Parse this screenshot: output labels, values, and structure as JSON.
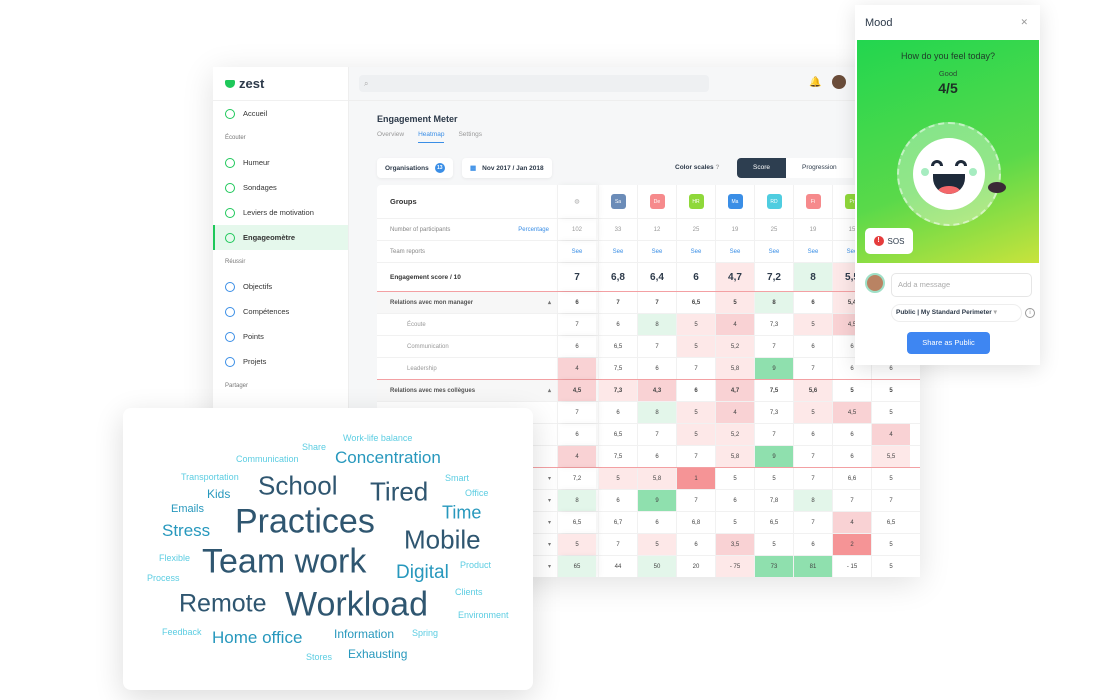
{
  "sidebar": {
    "logo": "zest",
    "items": [
      {
        "label": "Accueil"
      },
      {
        "section": "Écouter"
      },
      {
        "label": "Humeur"
      },
      {
        "label": "Sondages"
      },
      {
        "label": "Leviers de motivation"
      },
      {
        "label": "Engageomètre",
        "active": true
      },
      {
        "section": "Réussir"
      },
      {
        "label": "Objectifs"
      },
      {
        "label": "Compétences"
      },
      {
        "label": "Points"
      },
      {
        "label": "Projets"
      },
      {
        "section": "Partager"
      }
    ]
  },
  "page": {
    "title": "Engagement Meter",
    "tabs": [
      "Overview",
      "Heatmap",
      "Settings"
    ],
    "active_tab": "Heatmap",
    "organisations": "Organisations",
    "org_count": "13",
    "date_range": "Nov 2017 / Jan 2018",
    "color_scales": "Color scales",
    "scale_options": [
      "Score",
      "Progression"
    ],
    "scale_selected": "Score"
  },
  "heatmap": {
    "groups_label": "Groups",
    "columns": [
      {
        "tag": "Sa",
        "color": "#6b8cb8"
      },
      {
        "tag": "De",
        "color": "#f68a8c"
      },
      {
        "tag": "HR",
        "color": "#8fd83a"
      },
      {
        "tag": "Ma",
        "color": "#3a8ee6"
      },
      {
        "tag": "RD",
        "color": "#4fcde0"
      },
      {
        "tag": "Fi",
        "color": "#f68a8c"
      },
      {
        "tag": "Pr",
        "color": "#8fd83a"
      }
    ],
    "participants_label": "Number of participants",
    "percentage": "Percentage",
    "participants": [
      "102",
      "33",
      "12",
      "25",
      "19",
      "25",
      "19",
      "15"
    ],
    "team_reports_label": "Team reports",
    "see": "See",
    "rows": [
      {
        "label": "Engagement score / 10",
        "type": "big",
        "values": [
          "7",
          "6,8",
          "6,4",
          "6",
          "4,7",
          "7,2",
          "8",
          "5,5"
        ],
        "tones": [
          "",
          "",
          "",
          "",
          "r1",
          "",
          "g1",
          "r1"
        ]
      },
      {
        "label": "Relations avec mon manager",
        "type": "bold",
        "values": [
          "6",
          "7",
          "7",
          "6,5",
          "5",
          "8",
          "6",
          "5,4"
        ],
        "tones": [
          "",
          "",
          "",
          "",
          "r1",
          "g1",
          "",
          "r1"
        ]
      },
      {
        "label": "Écoute",
        "type": "sub",
        "values": [
          "7",
          "6",
          "8",
          "5",
          "4",
          "7,3",
          "5",
          "4,5"
        ],
        "tones": [
          "",
          "",
          "g1",
          "r1",
          "r2",
          "",
          "r1",
          "r2"
        ]
      },
      {
        "label": "Communication",
        "type": "sub",
        "values": [
          "6",
          "6,5",
          "7",
          "5",
          "5,2",
          "7",
          "6",
          "6"
        ],
        "tones": [
          "",
          "",
          "",
          "r1",
          "r1",
          "",
          "",
          ""
        ]
      },
      {
        "label": "Leadership",
        "type": "sub",
        "values": [
          "4",
          "7,5",
          "6",
          "7",
          "5,8",
          "9",
          "7",
          "6",
          "6"
        ],
        "tones": [
          "r2",
          "",
          "",
          "",
          "r1",
          "g2",
          "",
          "",
          ""
        ]
      },
      {
        "label": "Relations avec mes collègues",
        "type": "bold",
        "values": [
          "4,5",
          "7,3",
          "4,3",
          "6",
          "4,7",
          "7,5",
          "5,6",
          "5",
          "5"
        ],
        "tones": [
          "r2",
          "r1",
          "r2",
          "",
          "r2",
          "",
          "r1",
          "",
          ""
        ]
      },
      {
        "label": "",
        "type": "sub",
        "values": [
          "7",
          "6",
          "8",
          "5",
          "4",
          "7,3",
          "5",
          "4,5",
          "5"
        ],
        "tones": [
          "",
          "",
          "g1",
          "r1",
          "r2",
          "",
          "r1",
          "r2",
          ""
        ]
      },
      {
        "label": "",
        "type": "sub",
        "values": [
          "6",
          "6,5",
          "7",
          "5",
          "5,2",
          "7",
          "6",
          "6",
          "4"
        ],
        "tones": [
          "",
          "",
          "",
          "r1",
          "r1",
          "",
          "",
          "",
          "r2"
        ]
      },
      {
        "label": "",
        "type": "sub",
        "values": [
          "4",
          "7,5",
          "6",
          "7",
          "5,8",
          "9",
          "7",
          "6",
          "5,5"
        ],
        "tones": [
          "r2",
          "",
          "",
          "",
          "r1",
          "g2",
          "",
          "",
          "r1"
        ]
      },
      {
        "label": "",
        "type": "arrow",
        "values": [
          "7,2",
          "5",
          "5,8",
          "1",
          "5",
          "5",
          "7",
          "6,6",
          "5"
        ],
        "tones": [
          "",
          "r1",
          "r1",
          "r3",
          "",
          "",
          "",
          "",
          ""
        ]
      },
      {
        "label": "",
        "type": "arrow",
        "values": [
          "8",
          "6",
          "9",
          "7",
          "6",
          "7,8",
          "8",
          "7",
          "7"
        ],
        "tones": [
          "g1",
          "",
          "g2",
          "",
          "",
          "",
          "g1",
          "",
          ""
        ]
      },
      {
        "label": "",
        "type": "arrow",
        "values": [
          "6,5",
          "6,7",
          "6",
          "6,8",
          "5",
          "6,5",
          "7",
          "4",
          "6,5"
        ],
        "tones": [
          "",
          "",
          "",
          "",
          "",
          "",
          "",
          "r2",
          ""
        ]
      },
      {
        "label": "",
        "type": "arrow",
        "values": [
          "5",
          "7",
          "5",
          "6",
          "3,5",
          "5",
          "6",
          "2",
          "5"
        ],
        "tones": [
          "r1",
          "",
          "r1",
          "",
          "r2",
          "",
          "",
          "r3",
          ""
        ]
      },
      {
        "label": "",
        "type": "arrow",
        "values": [
          "65",
          "44",
          "50",
          "20",
          "- 75",
          "73",
          "81",
          "- 15",
          "5"
        ],
        "tones": [
          "g1",
          "",
          "g1",
          "",
          "r1",
          "g2",
          "g2",
          "",
          ""
        ]
      }
    ]
  },
  "wordcloud": [
    "Work-life balance",
    "Share",
    "Communication",
    "Concentration",
    "Transportation",
    "School",
    "Tired",
    "Smart",
    "Office",
    "Kids",
    "Emails",
    "Time",
    "Practices",
    "Stress",
    "Mobile",
    "Flexible",
    "Team work",
    "Digital",
    "Product",
    "Process",
    "Clients",
    "Remote",
    "Workload",
    "Environment",
    "Feedback",
    "Home office",
    "Information",
    "Spring",
    "Stores",
    "Exhausting"
  ],
  "mood": {
    "title": "Mood",
    "question": "How do you feel today?",
    "label": "Good",
    "score": "4/5",
    "sos": "SOS",
    "message_placeholder": "Add a message",
    "visibility": "Public | My Standard Perimeter",
    "share": "Share as Public",
    "accent": "#3e86f2"
  }
}
